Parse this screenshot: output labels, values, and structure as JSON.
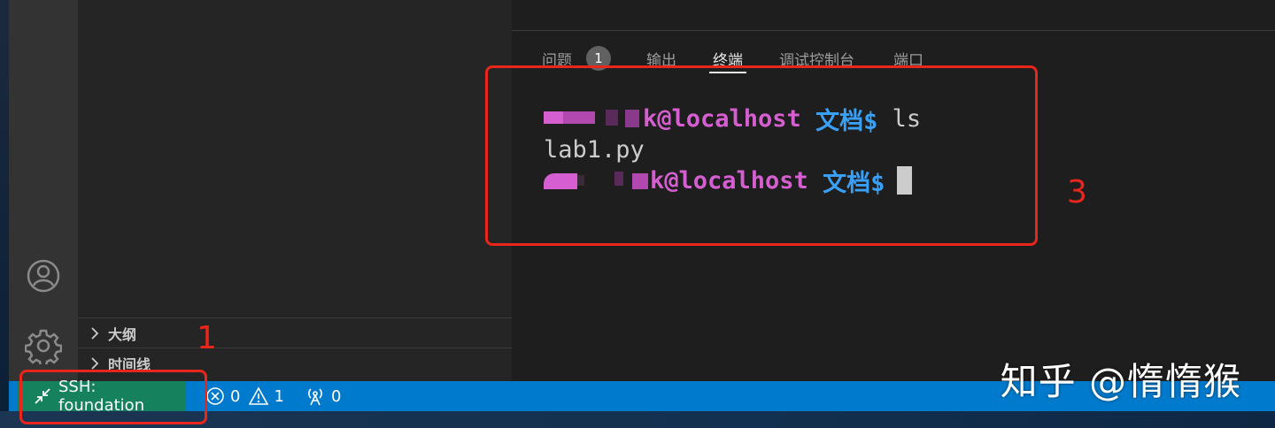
{
  "sidebar": {
    "sections": [
      {
        "label": "大纲"
      },
      {
        "label": "时间线"
      }
    ]
  },
  "panel": {
    "tabs": [
      {
        "label": "问题",
        "badge": "1"
      },
      {
        "label": "输出"
      },
      {
        "label": "终端",
        "active": true
      },
      {
        "label": "调试控制台"
      },
      {
        "label": "端口"
      }
    ]
  },
  "terminal": {
    "lines": [
      {
        "host": "k@localhost",
        "dir": "文档$",
        "command": "ls"
      },
      {
        "output": "lab1.py"
      },
      {
        "host": "k@localhost",
        "dir": "文档$",
        "command": ""
      }
    ]
  },
  "statusbar": {
    "remote_label": "SSH: foundation",
    "errors": "0",
    "warnings": "1",
    "ports": "0"
  },
  "annotations": {
    "box1": "1",
    "box3": "3"
  },
  "watermark": "知乎 @惰惰猴",
  "colors": {
    "accent_statusbar": "#007acc",
    "remote_indicator": "#16825d",
    "annotation_red": "#e8261c",
    "prompt_host": "#d55fd0",
    "prompt_dir": "#3aa0f5"
  },
  "icons": {
    "account": "account-icon",
    "settings": "gear-icon",
    "remote": "remote-icon",
    "error": "error-icon",
    "warning": "warning-icon",
    "ports": "broadcast-icon"
  }
}
